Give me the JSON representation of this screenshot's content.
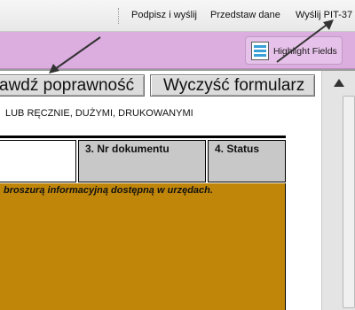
{
  "toolbar": {
    "sign_send": "Podpisz i wyślij",
    "present_data": "Przedstaw dane",
    "send_pit": "Wyślij PIT-37"
  },
  "forms_bar": {
    "highlight_label": "Highlight Fields"
  },
  "form": {
    "check_button": "awdź poprawność",
    "clear_button": "Wyczyść formularz",
    "instruction": "LUB RĘCZNIE, DUŻYMI, DRUKOWANYMI",
    "field_doc_number": "3. Nr dokumentu",
    "field_status": "4. Status",
    "info_text": "broszurą informacyjną dostępną w urzędach."
  },
  "colors": {
    "forms_bar_bg": "#dcaee0",
    "info_block_bg": "#c0860a",
    "header_cell_bg": "#c8c8c8"
  },
  "icons": [
    "highlight-fields-icon",
    "scroll-up-arrow-icon",
    "annotation-arrow-icon"
  ]
}
